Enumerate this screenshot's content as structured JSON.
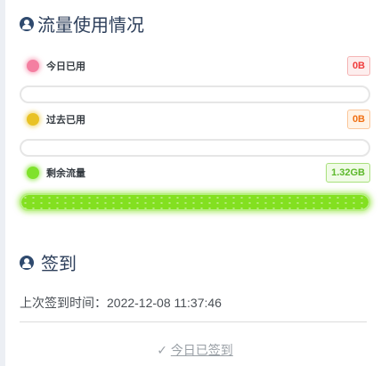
{
  "traffic": {
    "title": "流量使用情况",
    "today": {
      "label": "今日已用",
      "value": "0B",
      "percent": 0
    },
    "past": {
      "label": "过去已用",
      "value": "0B",
      "percent": 0
    },
    "remaining": {
      "label": "剩余流量",
      "value": "1.32GB",
      "percent": 100
    }
  },
  "checkin": {
    "title": "签到",
    "last_label": "上次签到时间：",
    "last_time": "2022-12-08 11:37:46",
    "check_icon": "✓",
    "button_label": "今日已签到"
  },
  "colors": {
    "title": "#2c3e5a",
    "today_dot": "#f47fa1",
    "past_dot": "#e9c224",
    "remaining_dot": "#7fe22c",
    "bar_fill": "#83e020"
  },
  "icons": {
    "section_title": "user-circle-icon",
    "dot_icon": "circle"
  }
}
